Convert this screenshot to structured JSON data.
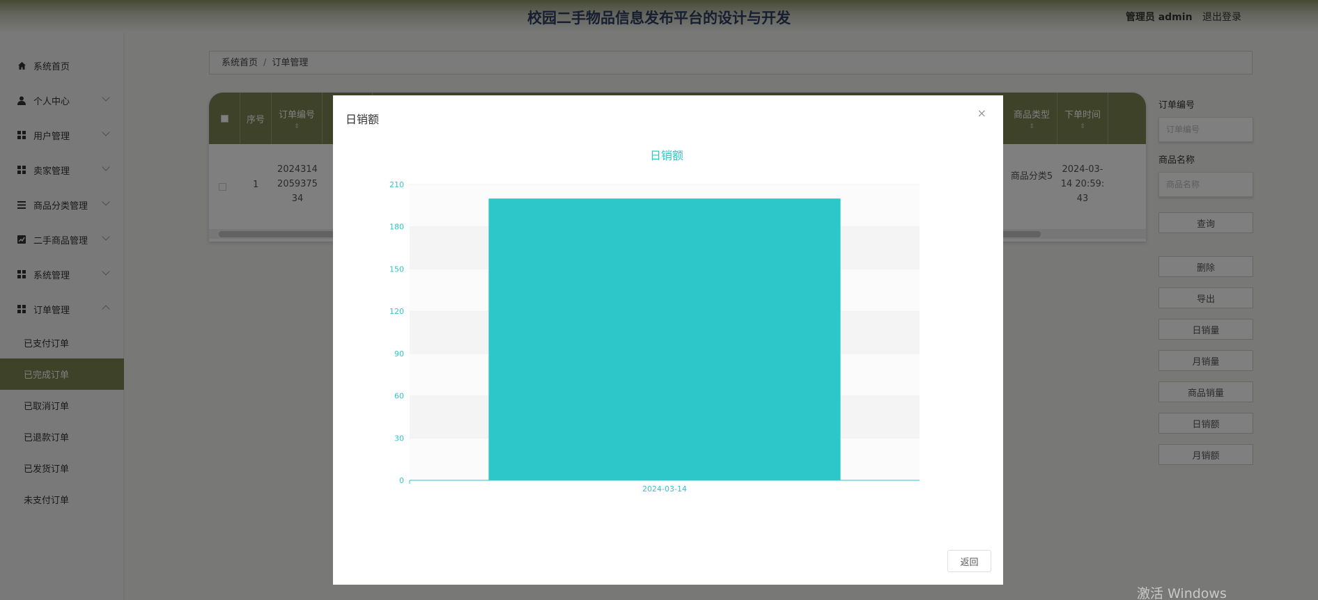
{
  "header": {
    "title": "校园二手物品信息发布平台的设计与开发",
    "user": "管理员 admin",
    "logout": "退出登录"
  },
  "sidebar": {
    "items": [
      {
        "label": "系统首页",
        "icon": "home-icon"
      },
      {
        "label": "个人中心",
        "icon": "user-icon"
      },
      {
        "label": "用户管理",
        "icon": "grid-icon"
      },
      {
        "label": "卖家管理",
        "icon": "grid-icon"
      },
      {
        "label": "商品分类管理",
        "icon": "list-icon"
      },
      {
        "label": "二手商品管理",
        "icon": "chart-icon"
      },
      {
        "label": "系统管理",
        "icon": "grid-icon"
      },
      {
        "label": "订单管理",
        "icon": "grid-icon"
      }
    ],
    "sub_items": [
      "已支付订单",
      "已完成订单",
      "已取消订单",
      "已退款订单",
      "已发货订单",
      "未支付订单"
    ]
  },
  "breadcrumb": {
    "home": "系统首页",
    "sep": "/",
    "current": "订单管理"
  },
  "table": {
    "headers": {
      "index": "序号",
      "order_no": "订单编号",
      "category": "商品类型",
      "time": "下单时间"
    },
    "row": {
      "index": "1",
      "order_no": "20243142059375 34",
      "category": "商品分类5",
      "time": "2024-03-14 20:59:43"
    }
  },
  "search": {
    "order_label": "订单编号",
    "order_placeholder": "订单编号",
    "name_label": "商品名称",
    "name_placeholder": "商品名称"
  },
  "buttons": {
    "query": "查询",
    "delete": "删除",
    "export": "导出",
    "daily_qty": "日销量",
    "monthly_qty": "月销量",
    "product_qty": "商品销量",
    "daily_amount": "日销额",
    "monthly_amount": "月销额"
  },
  "modal": {
    "title": "日销额",
    "close": "×",
    "back": "返回"
  },
  "chart_data": {
    "type": "bar",
    "title": "日销额",
    "categories": [
      "2024-03-14"
    ],
    "values": [
      200
    ],
    "ylim": [
      0,
      210
    ],
    "yticks": [
      0,
      30,
      60,
      90,
      120,
      150,
      180,
      210
    ],
    "bar_color": "#2ec7c9",
    "axis_color": "#2ec7c9",
    "grid": true
  },
  "watermark": "激活 Windows"
}
